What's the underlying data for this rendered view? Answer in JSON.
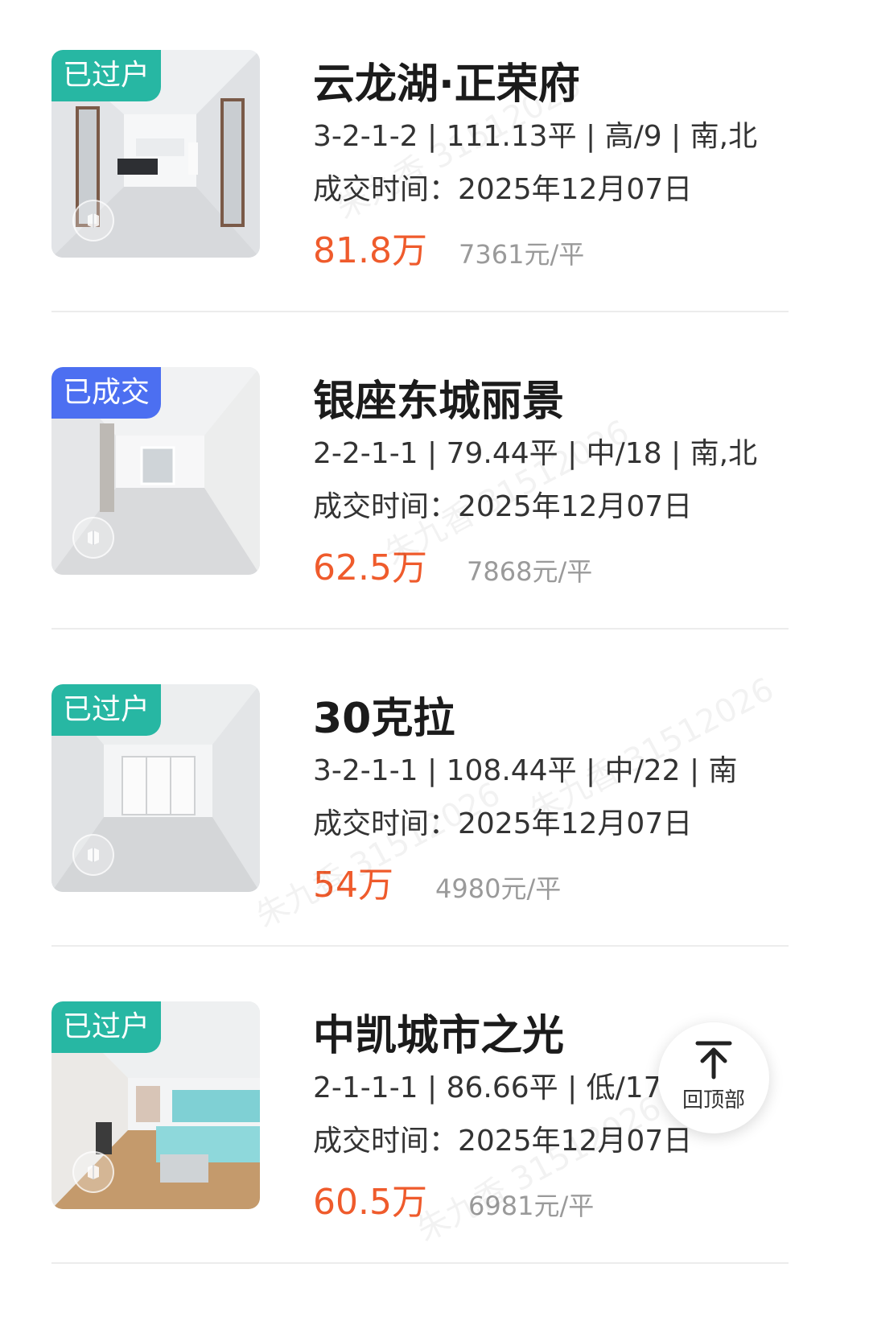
{
  "listings": [
    {
      "badge": "已过户",
      "badge_color": "#27b7a3",
      "title": "云龙湖·正荣府",
      "specs": "3-2-1-2 | 111.13平 | 高/9 | 南,北",
      "deal_time": "成交时间：2025年12月07日",
      "price": "81.8万",
      "unit_price": "7361元/平"
    },
    {
      "badge": "已成交",
      "badge_color": "#4c6ff1",
      "title": "银座东城丽景",
      "specs": "2-2-1-1 | 79.44平 | 中/18 | 南,北",
      "deal_time": "成交时间：2025年12月07日",
      "price": "62.5万",
      "unit_price": "7868元/平"
    },
    {
      "badge": "已过户",
      "badge_color": "#27b7a3",
      "title": "30克拉",
      "specs": "3-2-1-1 | 108.44平 | 中/22 | 南",
      "deal_time": "成交时间：2025年12月07日",
      "price": "54万",
      "unit_price": "4980元/平"
    },
    {
      "badge": "已过户",
      "badge_color": "#27b7a3",
      "title": "中凯城市之光",
      "specs": "2-1-1-1 | 86.66平 | 低/17 |",
      "deal_time": "成交时间：2025年12月07日",
      "price": "60.5万",
      "unit_price": "6981元/平"
    }
  ],
  "back_to_top": {
    "label": "回顶部",
    "icon": "arrow-up-icon"
  },
  "watermark": "朱九香 31512026",
  "colors": {
    "price": "#ef5b2c",
    "badge_teal": "#27b7a3",
    "badge_blue": "#4c6ff1"
  }
}
